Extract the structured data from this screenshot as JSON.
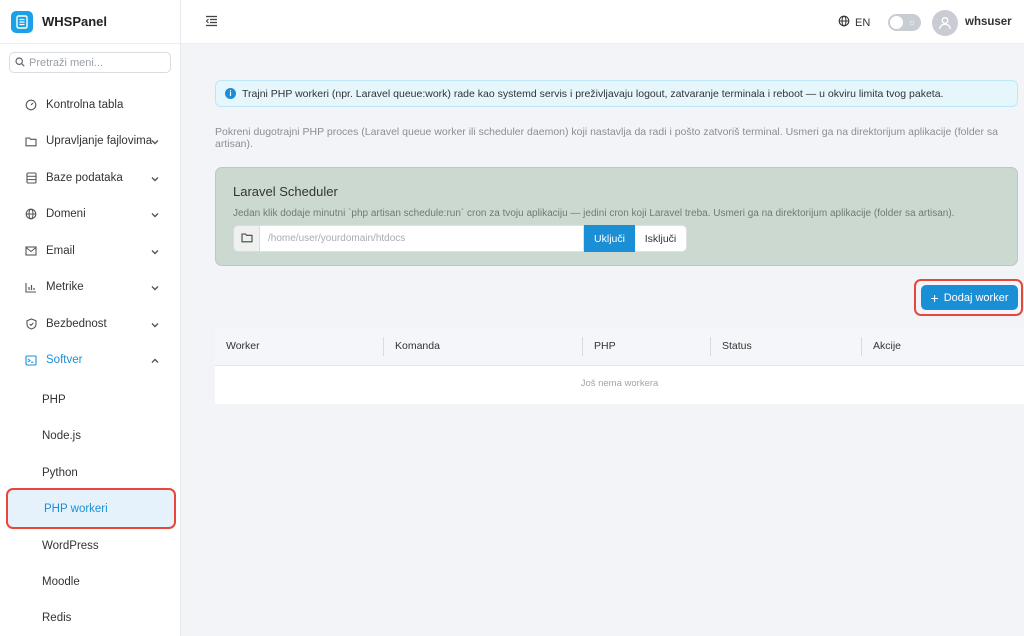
{
  "brand": {
    "name": "WHSPanel",
    "logo_icon": "server-icon",
    "accent": "#1ba1e6"
  },
  "search": {
    "placeholder": "Pretraži meni..."
  },
  "sidebar": {
    "items": [
      {
        "label": "Kontrolna tabla",
        "icon": "gauge-icon"
      },
      {
        "label": "Upravljanje fajlovima",
        "icon": "folder-icon"
      },
      {
        "label": "Baze podataka",
        "icon": "database-icon"
      },
      {
        "label": "Domeni",
        "icon": "globe-icon"
      },
      {
        "label": "Email",
        "icon": "mail-icon"
      },
      {
        "label": "Metrike",
        "icon": "chart-icon"
      },
      {
        "label": "Bezbednost",
        "icon": "shield-icon"
      },
      {
        "label": "Softver",
        "icon": "terminal-icon"
      }
    ],
    "subitems": [
      {
        "label": "PHP"
      },
      {
        "label": "Node.js"
      },
      {
        "label": "Python"
      },
      {
        "label": "PHP workeri"
      },
      {
        "label": "WordPress"
      },
      {
        "label": "Moodle"
      },
      {
        "label": "Redis"
      }
    ]
  },
  "topbar": {
    "language": "EN",
    "username": "whsuser"
  },
  "alert": {
    "text": "Trajni PHP workeri (npr. Laravel queue:work) rade kao systemd servis i preživljavaju logout, zatvaranje terminala i reboot — u okviru limita tvog paketa."
  },
  "description": "Pokreni dugotrajni PHP proces (Laravel queue worker ili scheduler daemon) koji nastavlja da radi i pošto zatvoriš terminal. Usmeri ga na direktorijum aplikacije (folder sa artisan).",
  "scheduler": {
    "title": "Laravel Scheduler",
    "description": "Jedan klik dodaje minutni `php artisan schedule:run` cron za tvoju aplikaciju — jedini cron koji Laravel treba. Usmeri ga na direktorijum aplikacije (folder sa artisan).",
    "path_placeholder": "/home/user/yourdomain/htdocs",
    "enable_label": "Uključi",
    "disable_label": "Isključi"
  },
  "add_worker_label": "Dodaj worker",
  "table": {
    "columns": [
      "Worker",
      "Komanda",
      "PHP",
      "Status",
      "Akcije"
    ],
    "empty_text": "Još nema workera"
  },
  "colors": {
    "primary": "#1b8fd6",
    "highlight": "#e8463a",
    "scheduler_bg": "#ccd9d0"
  }
}
